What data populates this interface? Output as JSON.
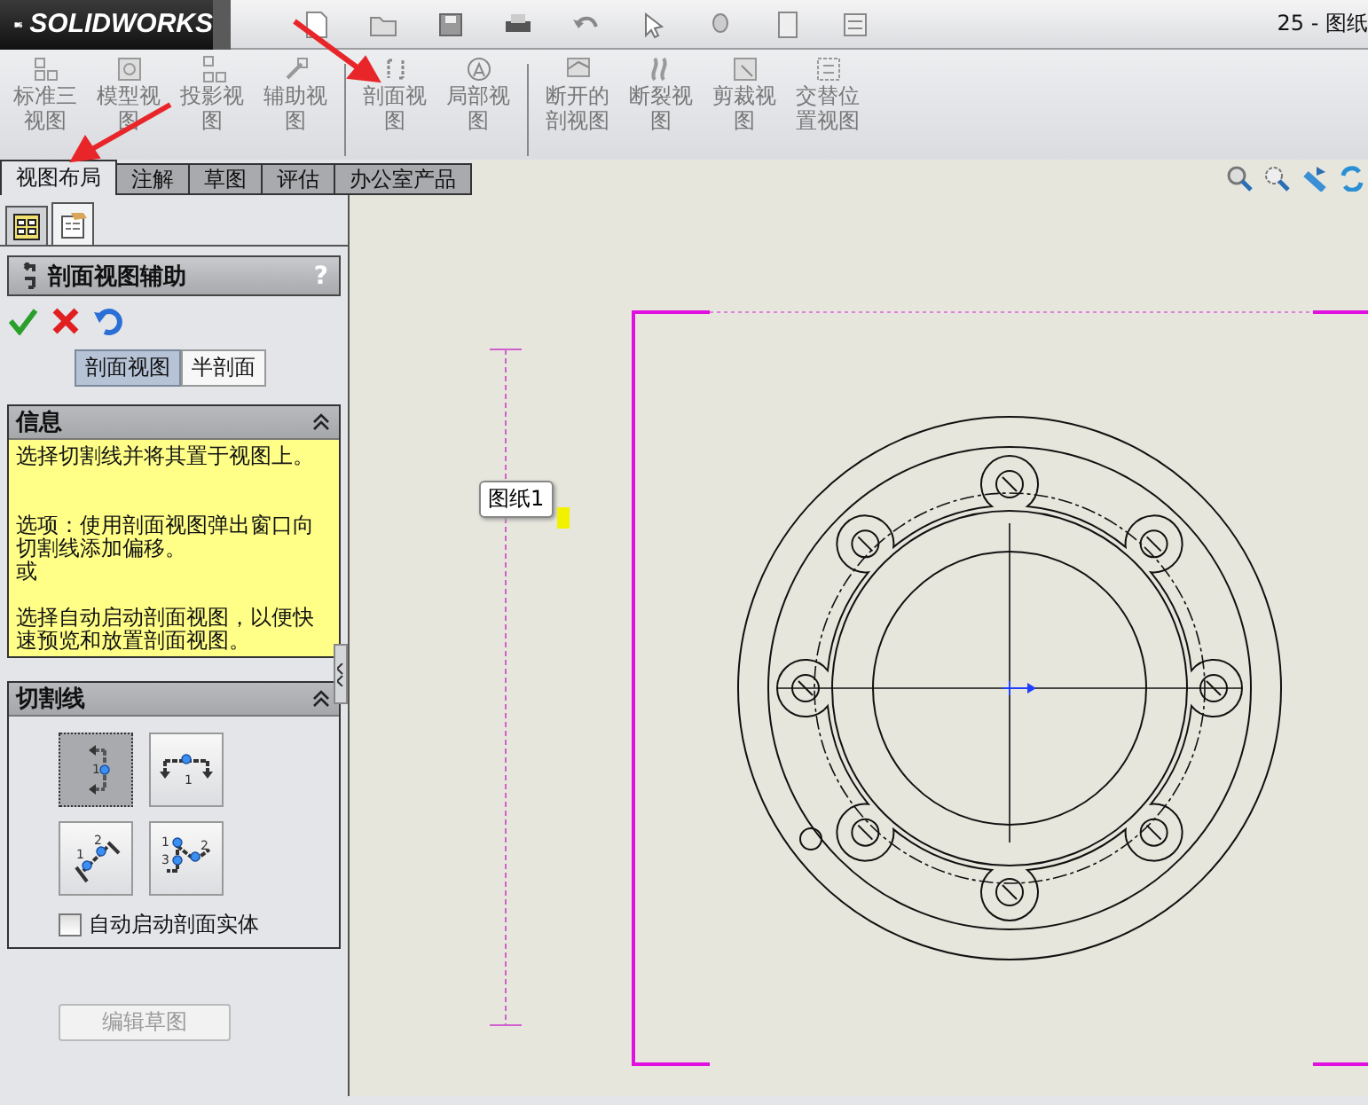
{
  "app": {
    "logo": "SOLIDWORKS",
    "title": "25 - 图纸"
  },
  "ribbon": {
    "groups": [
      {
        "buttons": [
          {
            "label": "标准三视图"
          },
          {
            "label": "模型视图"
          },
          {
            "label": "投影视图"
          },
          {
            "label": "辅助视图"
          }
        ]
      },
      {
        "buttons": [
          {
            "label": "剖面视图"
          },
          {
            "label": "局部视图"
          }
        ]
      },
      {
        "buttons": [
          {
            "label": "断开的剖视图"
          },
          {
            "label": "断裂视图"
          },
          {
            "label": "剪裁视图"
          },
          {
            "label": "交替位置视图"
          }
        ]
      }
    ]
  },
  "tabs": [
    {
      "label": "视图布局",
      "selected": true
    },
    {
      "label": "注解",
      "selected": false
    },
    {
      "label": "草图",
      "selected": false
    },
    {
      "label": "评估",
      "selected": false
    },
    {
      "label": "办公室产品",
      "selected": false
    }
  ],
  "panel_tabs": [
    {
      "kind": "tree",
      "selected": false
    },
    {
      "kind": "property",
      "selected": true
    }
  ],
  "property_manager": {
    "title": "剖面视图辅助",
    "help": "?",
    "mode_buttons": [
      {
        "label": "剖面视图",
        "selected": true
      },
      {
        "label": "半剖面",
        "selected": false
      }
    ],
    "info": {
      "title": "信息",
      "paragraphs": [
        "选择切割线并将其置于视图上。",
        "选项：使用剖面视图弹出窗口向切割线添加偏移。",
        "或",
        "选择自动启动剖面视图，以便快速预览和放置剖面视图。"
      ]
    },
    "cutting_line": {
      "title": "切割线",
      "options": [
        {
          "kind": "vertical",
          "selected": true,
          "numbers": [
            "1"
          ]
        },
        {
          "kind": "horizontal",
          "selected": false,
          "numbers": [
            "1"
          ]
        },
        {
          "kind": "aligned",
          "selected": false,
          "numbers": [
            "1",
            "2"
          ]
        },
        {
          "kind": "auxiliary",
          "selected": false,
          "numbers": [
            "1",
            "3",
            "2"
          ]
        }
      ],
      "checkbox": {
        "label": "自动启动剖面实体",
        "checked": false
      }
    },
    "edit_sketch": {
      "label": "编辑草图",
      "disabled": true
    }
  },
  "canvas": {
    "sheet_label": "图纸1"
  }
}
